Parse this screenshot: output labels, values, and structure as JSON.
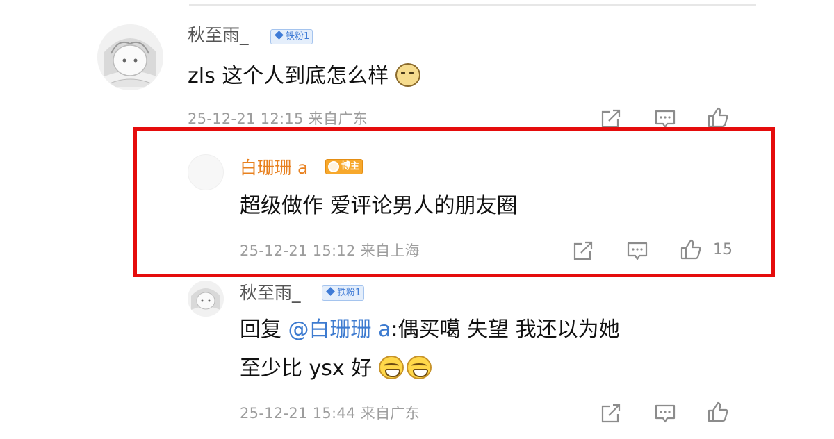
{
  "accent_colors": {
    "highlight_box": "#e50c0c",
    "mention": "#3d7bd0",
    "blogger_name": "#e8801e",
    "fan_badge": "#3f7bd6",
    "blogger_badge": "#f7a82c"
  },
  "comments": [
    {
      "username": "秋至雨_",
      "badge": "铁粉1",
      "text": "zls 这个人到底怎么样",
      "emoji": "doge-emoji",
      "timestamp": "25-12-21 12:15",
      "location": "来自广东",
      "actions": [
        "share-icon",
        "comment-icon",
        "like-icon"
      ]
    },
    {
      "username": "白珊珊 a",
      "badge": "博主",
      "text": "超级做作 爱评论男人的朋友圈",
      "timestamp": "25-12-21 15:12",
      "location": "来自上海",
      "like_count": "15",
      "highlighted": true,
      "actions": [
        "share-icon",
        "comment-icon",
        "like-icon"
      ]
    },
    {
      "username": "秋至雨_",
      "badge": "铁粉1",
      "reply_prefix": "回复 ",
      "mention": "@白珊珊 a",
      "text_line1": ":偶买噶 失望 我还以为她",
      "text_line2": "至少比 ysx 好",
      "emoji": [
        "grin-emoji",
        "grin-emoji"
      ],
      "timestamp": "25-12-21 15:44",
      "location": "来自广东",
      "actions": [
        "share-icon",
        "comment-icon",
        "like-icon"
      ]
    }
  ]
}
